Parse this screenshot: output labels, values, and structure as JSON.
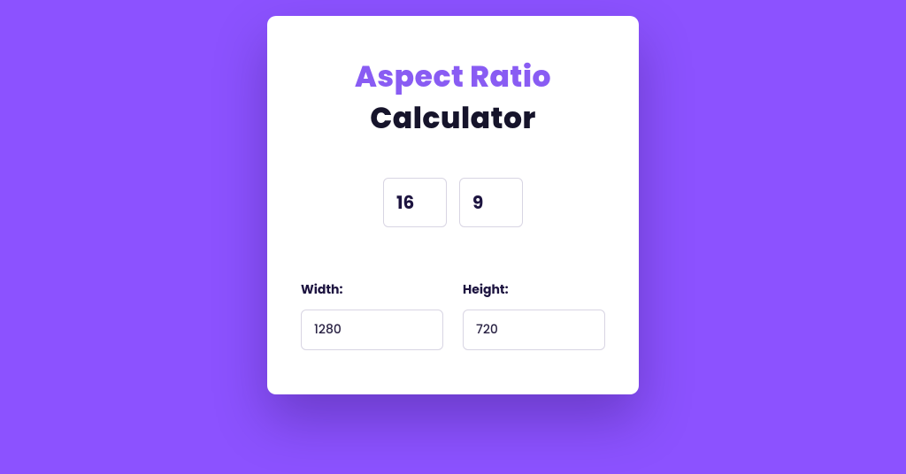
{
  "title": {
    "line1": "Aspect Ratio",
    "line2": "Calculator"
  },
  "ratio": {
    "w": "16",
    "h": "9"
  },
  "dims": {
    "width": {
      "label": "Width:",
      "value": "1280"
    },
    "height": {
      "label": "Height:",
      "value": "720"
    }
  }
}
